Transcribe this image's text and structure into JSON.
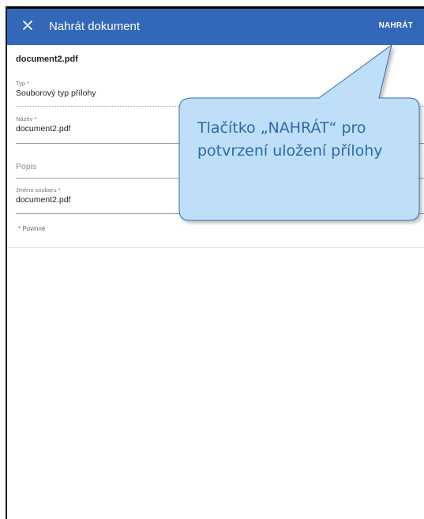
{
  "app_bar": {
    "title": "Nahrát dokument",
    "upload_label": "NAHRÁT",
    "background": "#3367b8"
  },
  "document": {
    "heading": "document2.pdf"
  },
  "form": {
    "type": {
      "label": "Typ *",
      "value": "Souborový typ přílohy"
    },
    "name": {
      "label": "Název *",
      "value": "document2.pdf"
    },
    "description": {
      "placeholder": "Popis"
    },
    "filename": {
      "label": "Jméno souboru *",
      "value": "document2.pdf"
    },
    "required_note": "* Povinné"
  },
  "callout": {
    "text": "Tlačítko „NAHRÁT“ pro potvrzení uložení přílohy",
    "fill": "#bfdef8",
    "stroke": "#2d6fb0",
    "text_color": "#2b6aa8"
  },
  "icons": {
    "close": "close-icon"
  }
}
